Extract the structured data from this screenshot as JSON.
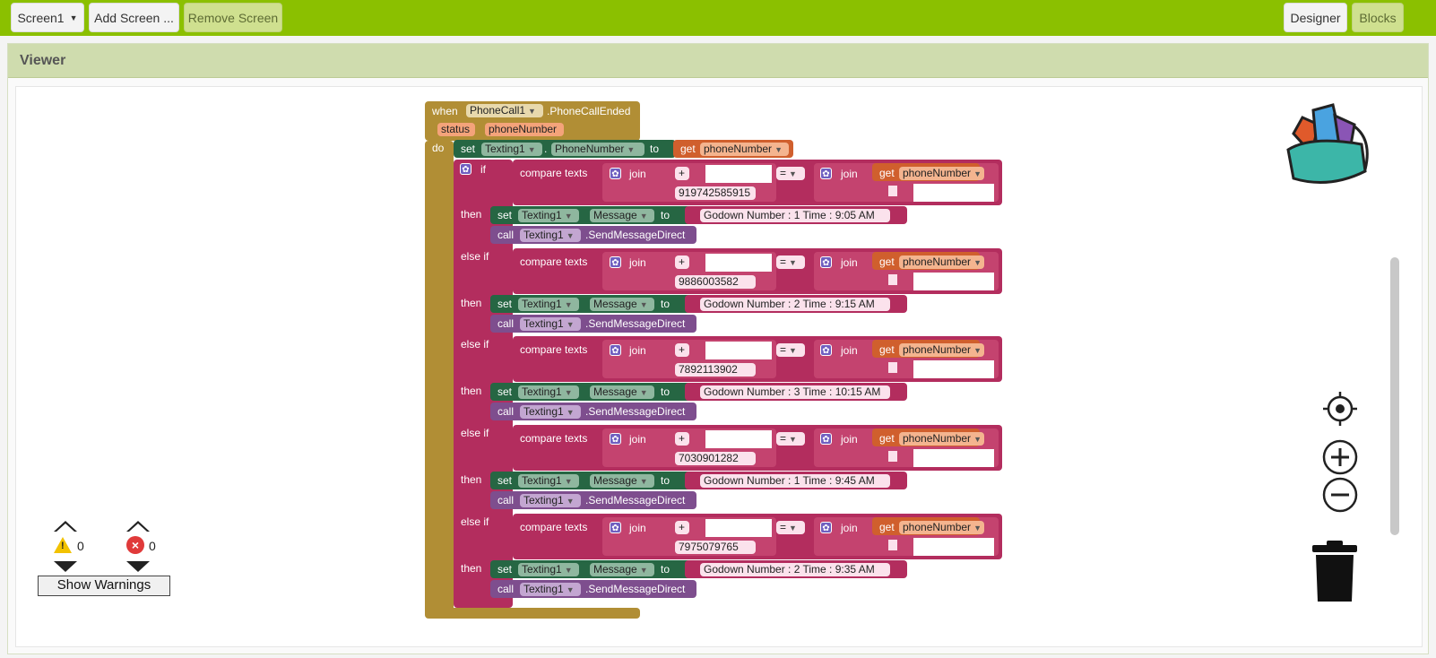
{
  "toolbar": {
    "screen_select": "Screen1",
    "add_screen": "Add Screen ...",
    "remove_screen": "Remove Screen",
    "designer": "Designer",
    "blocks": "Blocks"
  },
  "viewer": {
    "title": "Viewer"
  },
  "event": {
    "when": "when",
    "component": "PhoneCall1",
    "event_name": ".PhoneCallEnded",
    "param1": "status",
    "param2": "phoneNumber",
    "do": "do"
  },
  "first_set": {
    "set": "set",
    "component": "Texting1",
    "dot": ".",
    "property": "PhoneNumber",
    "to": "to",
    "get": "get",
    "var": "phoneNumber"
  },
  "labels": {
    "if": "if",
    "else_if": "else if",
    "then": "then",
    "compare": "compare texts",
    "join": "join",
    "equals": "=",
    "set": "set",
    "message": "Message",
    "to": "to",
    "call": "call",
    "send": ".SendMessageDirect",
    "texting": "Texting1",
    "get": "get",
    "var": "phoneNumber",
    "plus": "+"
  },
  "branches": [
    {
      "number": "919742585915",
      "message": "Godown Number : 1  Time : 9:05 AM"
    },
    {
      "number": "9886003582",
      "message": "Godown Number : 2  Time : 9:15 AM"
    },
    {
      "number": "7892113902",
      "message": "Godown Number : 3  Time : 10:15 AM"
    },
    {
      "number": "7030901282",
      "message": "Godown Number : 1  Time : 9:45 AM"
    },
    {
      "number": "7975079765",
      "message": "Godown Number : 2   Time : 9:35 AM"
    }
  ],
  "warnings": {
    "warn_count": "0",
    "error_count": "0",
    "show_button": "Show Warnings"
  },
  "colors": {
    "topbar": "#8bc000",
    "event": "#b18e35",
    "set": "#266643",
    "text": "#b32d5e",
    "get": "#d05f2d",
    "call": "#7e4e8e"
  }
}
